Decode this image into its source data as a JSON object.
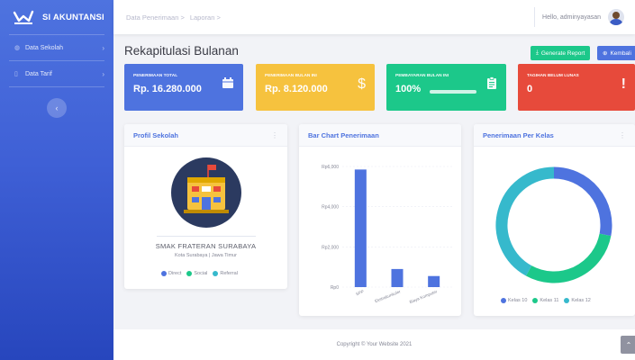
{
  "sidebar": {
    "brand": "SI AKUNTANSI",
    "items": [
      {
        "label": "Data Sekolah",
        "icon": "gauge-icon"
      },
      {
        "label": "Data Tarif",
        "icon": "document-icon"
      }
    ]
  },
  "topbar": {
    "breadcrumbs": [
      "Data Penerimaan >",
      "Laporan >"
    ],
    "username": "Hello, adminyayasan"
  },
  "page": {
    "title": "Rekapitulasi Bulanan",
    "generate_label": "Generate Report",
    "back_label": "Kembali"
  },
  "stats": [
    {
      "label": "PENERIMAAN TOTAL",
      "value": "Rp. 16.280.000",
      "color": "#4e73df"
    },
    {
      "label": "PENERIMAAN BULAN INI",
      "value": "Rp. 8.120.000",
      "color": "#f6c23e"
    },
    {
      "label": "PEMBAYARAN BULAN INI",
      "value": "100%",
      "progress": 100,
      "color": "#1cc88a"
    },
    {
      "label": "TAGIHAN BELUM LUNAS",
      "value": "0",
      "color": "#e74a3b"
    }
  ],
  "profile": {
    "title": "Profil Sekolah",
    "school_name": "SMAK FRATERAN SURABAYA",
    "city": "Kota Surabaya | Jawa Timur",
    "legend": [
      {
        "label": "Direct",
        "color": "#4e73df"
      },
      {
        "label": "Social",
        "color": "#1cc88a"
      },
      {
        "label": "Referral",
        "color": "#36b9cc"
      }
    ]
  },
  "bar_panel": {
    "title": "Bar Chart Penerimaan"
  },
  "donut_panel": {
    "title": "Penerimaan Per Kelas",
    "legend": [
      {
        "label": "Kelas 10",
        "color": "#4e73df"
      },
      {
        "label": "Kelas 11",
        "color": "#1cc88a"
      },
      {
        "label": "Kelas 12",
        "color": "#36b9cc"
      }
    ]
  },
  "chart_data": [
    {
      "type": "bar",
      "title": "Bar Chart Penerimaan",
      "categories": [
        "SPP",
        "Ekstrakurikuler",
        "Biaya Komputer"
      ],
      "values": [
        5850,
        900,
        550
      ],
      "ytick_labels": [
        "Rp0",
        "Rp2,000",
        "Rp4,000",
        "Rp6,000"
      ],
      "ylim": [
        0,
        6000
      ],
      "color": "#4e73df",
      "grid": true
    },
    {
      "type": "pie",
      "title": "Penerimaan Per Kelas",
      "categories": [
        "Kelas 10",
        "Kelas 11",
        "Kelas 12"
      ],
      "values": [
        28,
        30,
        42
      ],
      "colors": [
        "#4e73df",
        "#1cc88a",
        "#36b9cc"
      ],
      "legend": "bottom"
    }
  ],
  "footer": {
    "text": "Copyright © Your Website 2021"
  }
}
